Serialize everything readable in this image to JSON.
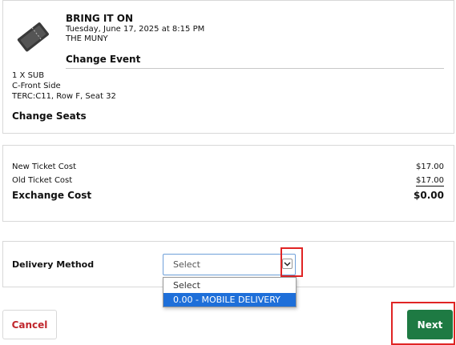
{
  "event": {
    "title": "BRING IT ON",
    "date": "Tuesday, June 17, 2025 at 8:15 PM",
    "venue": "THE MUNY",
    "change_event_label": "Change Event",
    "icon": "ticket-icon"
  },
  "ticket": {
    "quantity": "1 X SUB",
    "section": "C-Front Side",
    "seat": "TERC:C11, Row F, Seat 32",
    "change_seats_label": "Change Seats"
  },
  "costs": {
    "new_label": "New Ticket Cost",
    "new_value": "$17.00",
    "old_label": "Old Ticket Cost",
    "old_value": "$17.00",
    "exchange_label": "Exchange Cost",
    "exchange_value": "$0.00"
  },
  "delivery": {
    "label": "Delivery Method",
    "selected": "Select",
    "options": [
      "Select",
      "0.00 - MOBILE DELIVERY"
    ]
  },
  "actions": {
    "cancel_label": "Cancel",
    "next_label": "Next"
  },
  "colors": {
    "accent_green": "#1e7a43",
    "cancel_red": "#c0262c",
    "option_highlight": "#1e6fd9",
    "annotation_red": "#e02424"
  }
}
